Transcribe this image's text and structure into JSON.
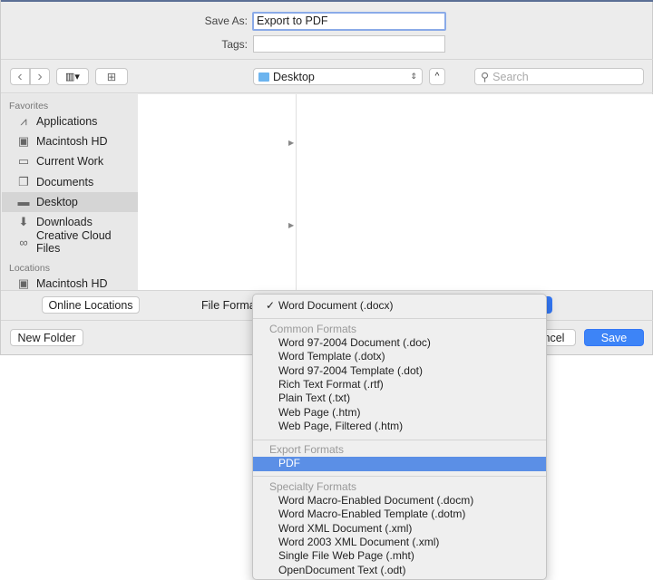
{
  "header": {
    "save_as_label": "Save As:",
    "save_as_value": "Export to PDF",
    "tags_label": "Tags:",
    "tags_value": ""
  },
  "toolbar": {
    "back": "‹",
    "forward": "›",
    "view": "▥▾",
    "new_folder_icon": "⊞",
    "location": "Desktop",
    "search_placeholder": "Search"
  },
  "sidebar": {
    "favorites_heading": "Favorites",
    "items": [
      {
        "label": "Applications",
        "icon": "applications-icon",
        "glyph": "⩘"
      },
      {
        "label": "Macintosh HD",
        "icon": "disk-icon",
        "glyph": "▣"
      },
      {
        "label": "Current Work",
        "icon": "folder-icon",
        "glyph": "▭"
      },
      {
        "label": "Documents",
        "icon": "documents-icon",
        "glyph": "❐"
      },
      {
        "label": "Desktop",
        "icon": "desktop-icon",
        "glyph": "▬",
        "selected": true
      },
      {
        "label": "Downloads",
        "icon": "downloads-icon",
        "glyph": "⬇"
      },
      {
        "label": "Creative Cloud Files",
        "icon": "creative-cloud-icon",
        "glyph": "∞"
      }
    ],
    "locations_heading": "Locations",
    "locations": [
      {
        "label": "Macintosh HD",
        "icon": "disk-icon",
        "glyph": "▣"
      }
    ]
  },
  "footer": {
    "online_locations": "Online Locations",
    "file_format_label": "File Format:",
    "new_folder": "New Folder",
    "cancel": "Cancel",
    "save": "Save"
  },
  "menu": {
    "selected": "Word Document (.docx)",
    "check": "✓",
    "common_heading": "Common Formats",
    "common": [
      "Word 97-2004 Document (.doc)",
      "Word Template (.dotx)",
      "Word 97-2004 Template (.dot)",
      "Rich Text Format (.rtf)",
      "Plain Text (.txt)",
      "Web Page (.htm)",
      "Web Page, Filtered (.htm)"
    ],
    "export_heading": "Export Formats",
    "export": [
      "PDF"
    ],
    "specialty_heading": "Specialty Formats",
    "specialty": [
      "Word Macro-Enabled Document (.docm)",
      "Word Macro-Enabled Template (.dotm)",
      "Word XML Document (.xml)",
      "Word 2003 XML Document (.xml)",
      "Single File Web Page (.mht)",
      "OpenDocument Text (.odt)"
    ],
    "highlighted": "PDF"
  },
  "colors": {
    "accent": "#3478f6",
    "highlight": "#5b8fe6"
  }
}
